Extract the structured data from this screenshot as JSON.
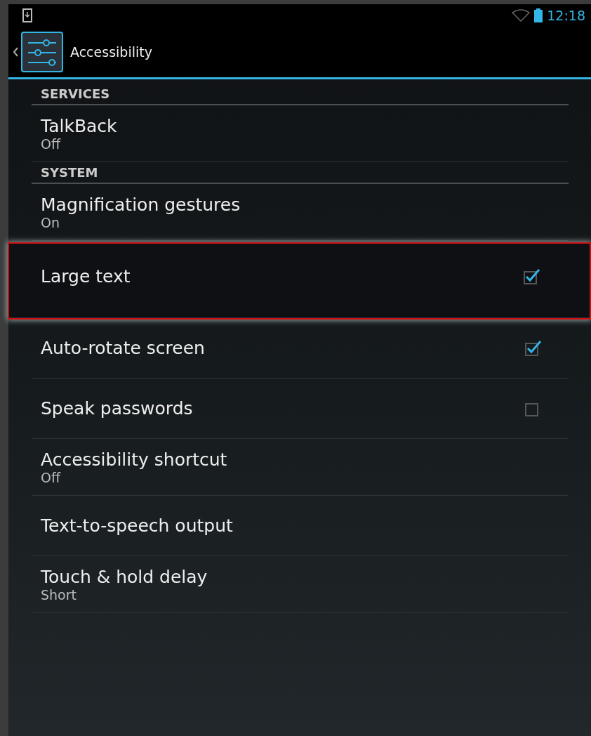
{
  "status_bar": {
    "time": "12:18"
  },
  "action_bar": {
    "title": "Accessibility"
  },
  "sections": [
    {
      "header": "SERVICES",
      "items": [
        {
          "kind": "summary",
          "title": "TalkBack",
          "summary": "Off",
          "highlighted": false
        }
      ]
    },
    {
      "header": "SYSTEM",
      "items": [
        {
          "kind": "summary",
          "title": "Magnification gestures",
          "summary": "On",
          "highlighted": false
        },
        {
          "kind": "checkbox",
          "title": "Large text",
          "checked": true,
          "highlighted": true
        },
        {
          "kind": "checkbox",
          "title": "Auto-rotate screen",
          "checked": true,
          "highlighted": false
        },
        {
          "kind": "checkbox",
          "title": "Speak passwords",
          "checked": false,
          "highlighted": false
        },
        {
          "kind": "summary",
          "title": "Accessibility shortcut",
          "summary": "Off",
          "highlighted": false
        },
        {
          "kind": "plain",
          "title": "Text-to-speech output",
          "highlighted": false
        },
        {
          "kind": "summary",
          "title": "Touch & hold delay",
          "summary": "Short",
          "highlighted": false
        }
      ]
    }
  ]
}
